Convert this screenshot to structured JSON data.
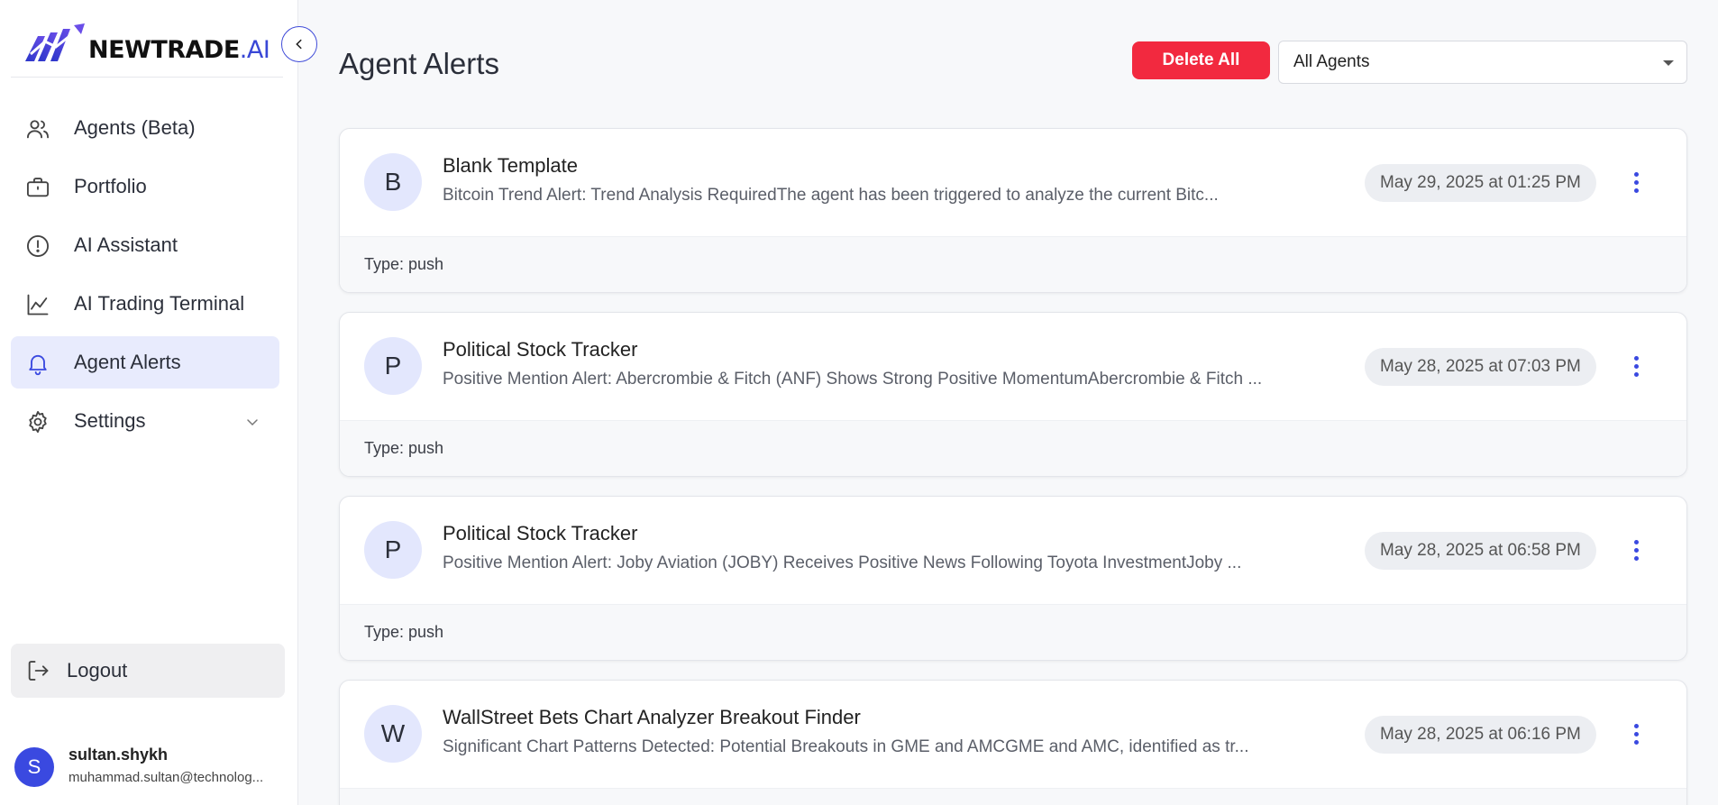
{
  "brand": {
    "name_main": "NEWTRADE",
    "name_suffix": ".AI",
    "accent": "#3a49e0"
  },
  "sidebar": {
    "items": [
      {
        "label": "Agents (Beta)",
        "icon": "users-icon",
        "active": false
      },
      {
        "label": "Portfolio",
        "icon": "briefcase-icon",
        "active": false
      },
      {
        "label": "AI Assistant",
        "icon": "alert-circle-icon",
        "active": false
      },
      {
        "label": "AI Trading Terminal",
        "icon": "line-chart-icon",
        "active": false
      },
      {
        "label": "Agent Alerts",
        "icon": "bell-icon",
        "active": true
      },
      {
        "label": "Settings",
        "icon": "gear-icon",
        "active": false,
        "expandable": true
      }
    ],
    "logout_label": "Logout",
    "user": {
      "initial": "S",
      "username": "sultan.shykh",
      "email": "muhammad.sultan@technolog..."
    }
  },
  "header": {
    "title": "Agent Alerts",
    "delete_all_label": "Delete All",
    "filter": {
      "selected": "All Agents"
    }
  },
  "alerts": [
    {
      "initial": "B",
      "agent": "Blank Template",
      "message": "Bitcoin Trend Alert: Trend Analysis RequiredThe agent has been triggered to analyze the current Bitc...",
      "date": "May 29, 2025 at 01:25 PM",
      "type": "Type: push"
    },
    {
      "initial": "P",
      "agent": "Political Stock Tracker",
      "message": "Positive Mention Alert: Abercrombie & Fitch (ANF) Shows Strong Positive MomentumAbercrombie & Fitch ...",
      "date": "May 28, 2025 at 07:03 PM",
      "type": "Type: push"
    },
    {
      "initial": "P",
      "agent": "Political Stock Tracker",
      "message": "Positive Mention Alert: Joby Aviation (JOBY) Receives Positive News Following Toyota InvestmentJoby ...",
      "date": "May 28, 2025 at 06:58 PM",
      "type": "Type: push"
    },
    {
      "initial": "W",
      "agent": "WallStreet Bets Chart Analyzer Breakout Finder",
      "message": "Significant Chart Patterns Detected: Potential Breakouts in GME and AMCGME and AMC, identified as tr...",
      "date": "May 28, 2025 at 06:16 PM",
      "type": ""
    }
  ]
}
